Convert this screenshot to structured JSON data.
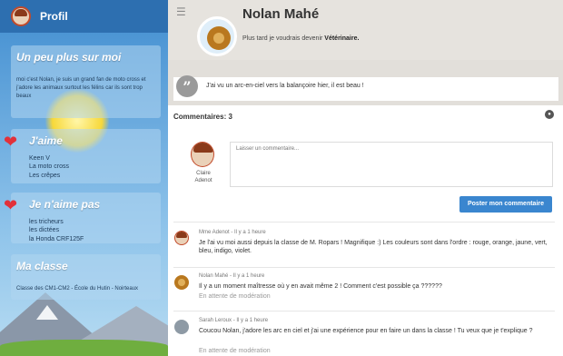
{
  "sidebar": {
    "profil_label": "Profil",
    "about": {
      "title": "Un peu plus sur moi",
      "text": "moi c'est Nolan, je suis un grand fan de moto cross et j'adore les animaux surtout les félins car ils sont trop beaux"
    },
    "likes": {
      "title": "J'aime",
      "items": [
        "Keen V",
        "La moto cross",
        "Les crêpes"
      ]
    },
    "dislikes": {
      "title": "Je n'aime pas",
      "items": [
        "les tricheurs",
        "les dictées",
        "la Honda CRF125F"
      ]
    },
    "class": {
      "title": "Ma classe",
      "text": "Classe des CM1-CM2 - École du Hutin - Noirteaux"
    }
  },
  "header": {
    "menu_icon": "hamburger-icon",
    "name": "Nolan Mahé",
    "tagline_prefix": "Plus tard je voudrais devenir",
    "tagline_job": "Vétérinaire."
  },
  "post": {
    "icon": "quote-icon",
    "text": "J'ai vu un arc-en-ciel vers la balançoire hier, il est beau !"
  },
  "comments": {
    "title": "Commentaires: 3",
    "me": {
      "name_line1": "Claire",
      "name_line2": "Adenot"
    },
    "input_placeholder": "Laisser un commentaire...",
    "post_button": "Poster mon commentaire",
    "items": [
      {
        "meta": "Mme Adenot - Il y a 1 heure",
        "text": "Je l'ai vu moi aussi depuis la classe de M. Ropars ! Magnifique :) Les couleurs sont dans l'ordre : rouge, orange, jaune, vert, bleu, indigo, violet.",
        "moderation": ""
      },
      {
        "meta": "Nolan Mahé - Il y a 1 heure",
        "text": "Il y a un moment maîtresse où y en avait même 2 ! Comment c'est possible ça ??????",
        "moderation": "En attente de modération"
      },
      {
        "meta": "Sarah Leroux - Il y a 1 heure",
        "text": "Coucou Nolan, j'adore les arc en ciel et j'ai une expérience pour en faire un dans la classe ! Tu veux que je t'explique ?",
        "moderation": "En attente de modération"
      }
    ]
  },
  "colors": {
    "accent": "#3a86cf",
    "heart": "#e2313a",
    "sidebar": "#3f88c8"
  }
}
